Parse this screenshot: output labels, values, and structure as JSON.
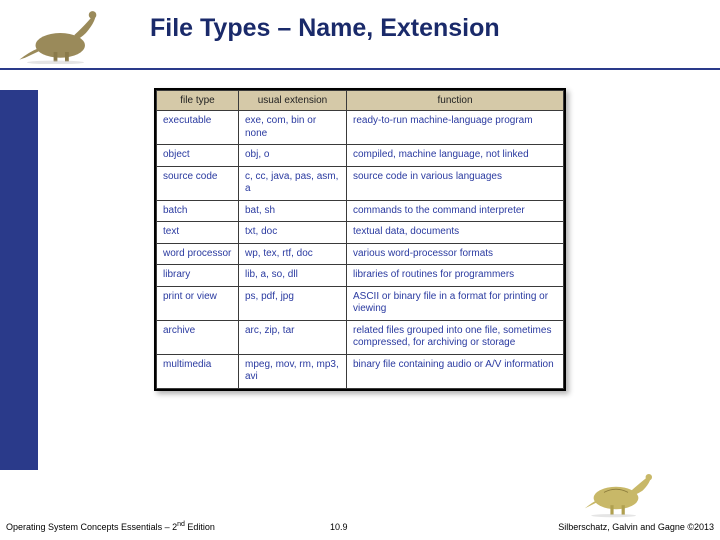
{
  "title": "File Types – Name, Extension",
  "table": {
    "headers": [
      "file type",
      "usual extension",
      "function"
    ],
    "rows": [
      [
        "executable",
        "exe, com, bin or none",
        "ready-to-run machine-language program"
      ],
      [
        "object",
        "obj, o",
        "compiled, machine language, not linked"
      ],
      [
        "source code",
        "c, cc, java, pas, asm, a",
        "source code in various languages"
      ],
      [
        "batch",
        "bat, sh",
        "commands to the command interpreter"
      ],
      [
        "text",
        "txt, doc",
        "textual data, documents"
      ],
      [
        "word processor",
        "wp, tex, rtf, doc",
        "various word-processor formats"
      ],
      [
        "library",
        "lib, a, so, dll",
        "libraries of routines for programmers"
      ],
      [
        "print or view",
        "ps, pdf, jpg",
        "ASCII or binary file in a format for printing or viewing"
      ],
      [
        "archive",
        "arc, zip, tar",
        "related files grouped into one file, sometimes compressed, for archiving or storage"
      ],
      [
        "multimedia",
        "mpeg, mov, rm, mp3, avi",
        "binary file containing audio or A/V information"
      ]
    ]
  },
  "footer": {
    "left_a": "Operating System Concepts Essentials – 2",
    "left_sup": "nd",
    "left_b": " Edition",
    "center": "10.9",
    "right": "Silberschatz, Galvin and Gagne ©2013"
  },
  "colors": {
    "accent": "#2a3a8a",
    "table_header_bg": "#d5c9a8",
    "table_text": "#2a3aa0"
  }
}
